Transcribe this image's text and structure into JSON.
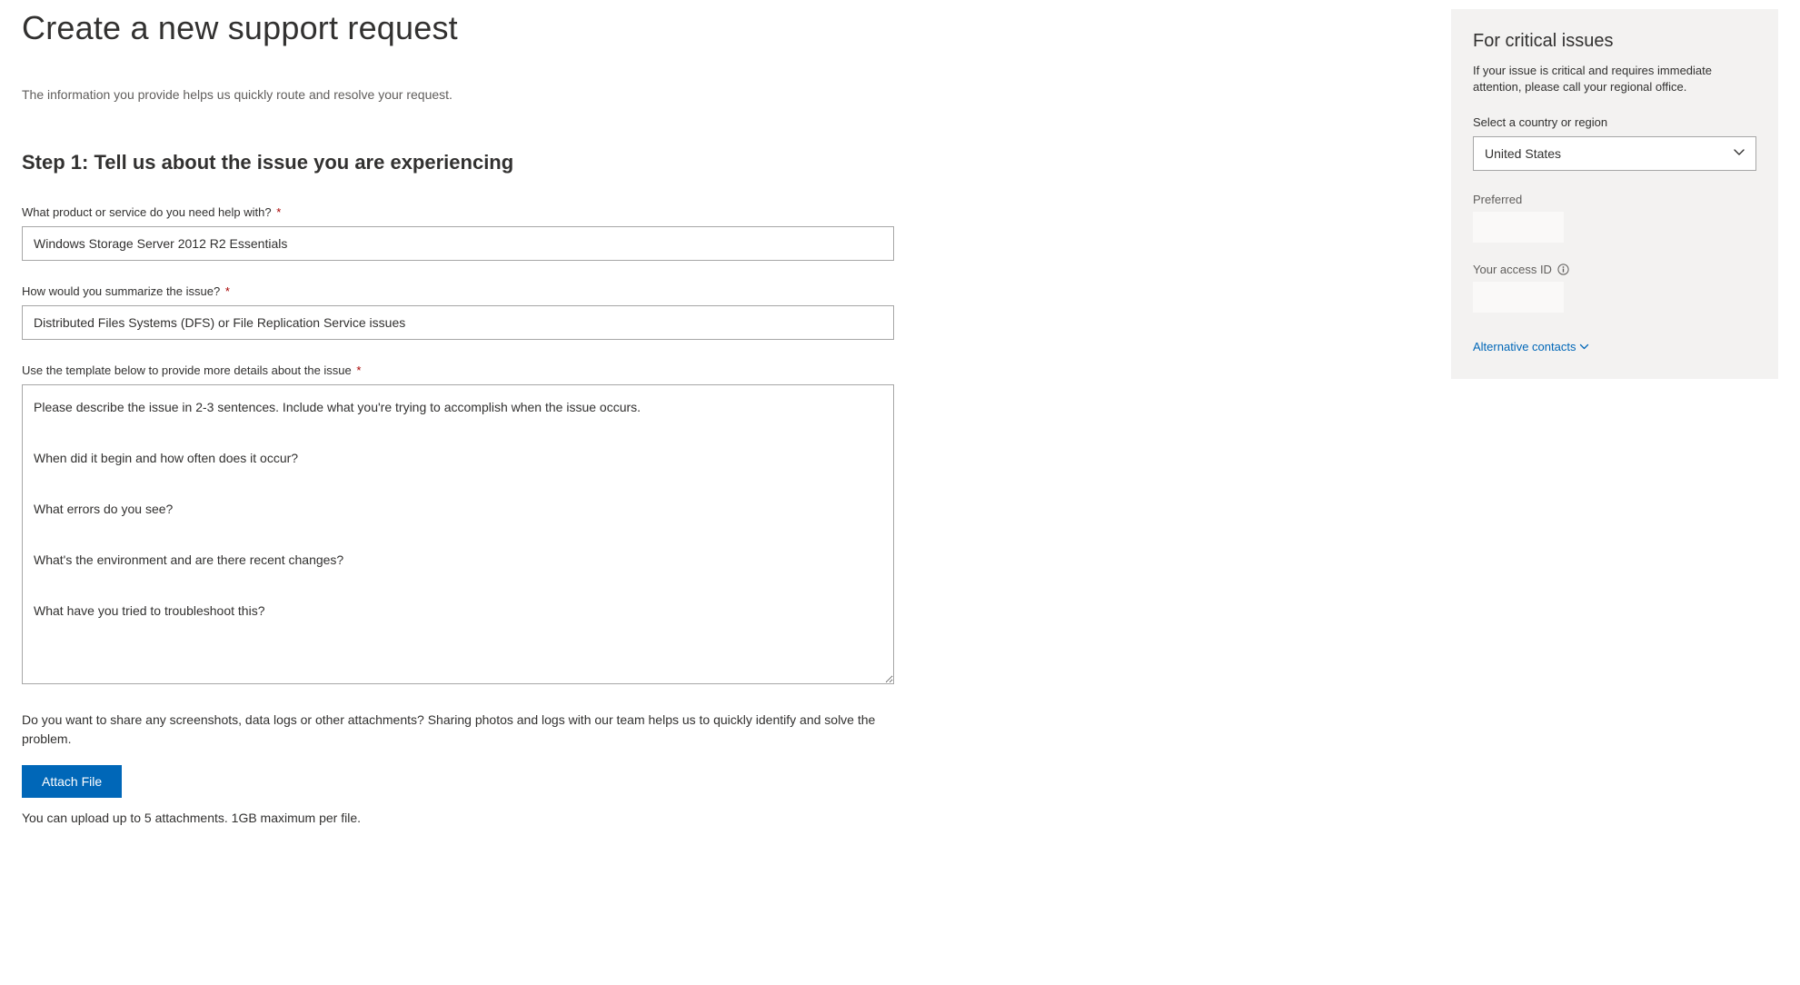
{
  "page": {
    "title": "Create a new support request",
    "intro": "The information you provide helps us quickly route and resolve your request."
  },
  "step1": {
    "heading": "Step 1: Tell us about the issue you are experiencing",
    "product_label": "What product or service do you need help with?",
    "product_value": "Windows Storage Server 2012 R2 Essentials",
    "summary_label": "How would you summarize the issue?",
    "summary_value": "Distributed Files Systems (DFS) or File Replication Service issues",
    "details_label": "Use the template below to provide more details about the issue",
    "details_value": "Please describe the issue in 2-3 sentences. Include what you're trying to accomplish when the issue occurs.\n\nWhen did it begin and how often does it occur?\n\nWhat errors do you see?\n\nWhat's the environment and are there recent changes?\n\nWhat have you tried to troubleshoot this?",
    "attach_desc": "Do you want to share any screenshots, data logs or other attachments? Sharing photos and logs with our team helps us to quickly identify and solve the problem.",
    "attach_button": "Attach File",
    "upload_note": "You can upload up to 5 attachments. 1GB maximum per file."
  },
  "sidebar": {
    "heading": "For critical issues",
    "desc": "If your issue is critical and requires immediate attention, please call your regional office.",
    "country_label": "Select a country or region",
    "country_selected": "United States",
    "preferred_label": "Preferred",
    "access_id_label": "Your access ID",
    "alt_contacts": "Alternative contacts"
  }
}
